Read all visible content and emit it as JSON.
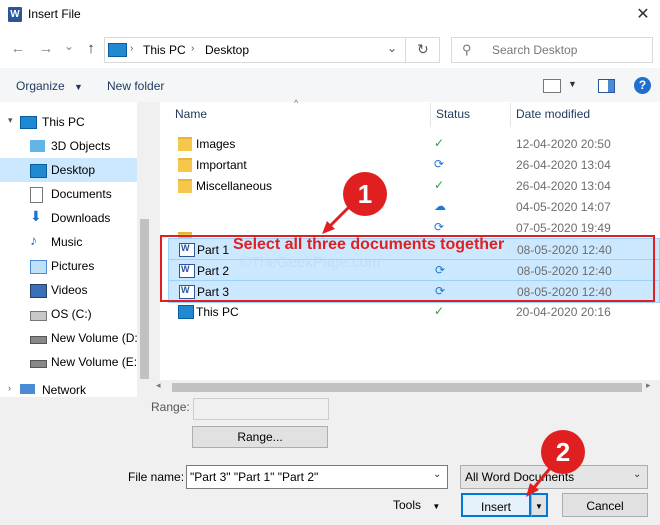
{
  "window": {
    "title": "Insert File",
    "app_icon": "W"
  },
  "nav": {
    "back_icon": "←",
    "forward_icon": "→",
    "dropdown_icon": "⌄",
    "up_icon": "↑",
    "breadcrumb": [
      "This PC",
      "Desktop"
    ],
    "refresh_icon": "↻",
    "search_placeholder": "Search Desktop"
  },
  "toolbar": {
    "organize": "Organize",
    "new_folder": "New folder"
  },
  "sidebar": {
    "items": [
      {
        "label": "This PC"
      },
      {
        "label": "3D Objects"
      },
      {
        "label": "Desktop"
      },
      {
        "label": "Documents"
      },
      {
        "label": "Downloads"
      },
      {
        "label": "Music"
      },
      {
        "label": "Pictures"
      },
      {
        "label": "Videos"
      },
      {
        "label": "OS (C:)"
      },
      {
        "label": "New Volume (D:"
      },
      {
        "label": "New Volume (E:)"
      },
      {
        "label": "Network"
      }
    ]
  },
  "columns": {
    "name": "Name",
    "status": "Status",
    "date": "Date modified"
  },
  "files": [
    {
      "name": "Images",
      "type": "folder",
      "status": "✓",
      "date": "12-04-2020 20:50"
    },
    {
      "name": "Important",
      "type": "folder",
      "status": "⟳",
      "date": "26-04-2020 13:04"
    },
    {
      "name": "Miscellaneous",
      "type": "folder",
      "status": "✓",
      "date": "26-04-2020 13:04"
    },
    {
      "name": "",
      "type": "blank",
      "status": "☁",
      "date": "04-05-2020 14:07"
    },
    {
      "name": "",
      "type": "blank",
      "status": "⟳",
      "date": "07-05-2020 19:49"
    },
    {
      "name": "Part 1",
      "type": "word",
      "status": "",
      "date": "08-05-2020 12:40"
    },
    {
      "name": "Part 2",
      "type": "word",
      "status": "⟳",
      "date": "08-05-2020 12:40"
    },
    {
      "name": "Part 3",
      "type": "word",
      "status": "⟳",
      "date": "08-05-2020 12:40"
    },
    {
      "name": "This PC",
      "type": "pc",
      "status": "✓",
      "date": "20-04-2020 20:16"
    }
  ],
  "annotations": {
    "step1_num": "1",
    "step1_text": "Select all three documents together",
    "step2_num": "2",
    "watermark": "©TheGeekPage.com"
  },
  "bottom": {
    "range_label": "Range:",
    "range_value": "",
    "range_button": "Range...",
    "filename_label": "File name:",
    "filename_value": "\"Part 3\" \"Part 1\" \"Part 2\"",
    "filetype_value": "All Word Documents",
    "tools_label": "Tools",
    "insert_label": "Insert",
    "cancel_label": "Cancel"
  },
  "colors": {
    "accent": "#0078d7",
    "annotation": "#e02020",
    "status_ok": "#2e9e44",
    "status_sync": "#1f78d1"
  }
}
